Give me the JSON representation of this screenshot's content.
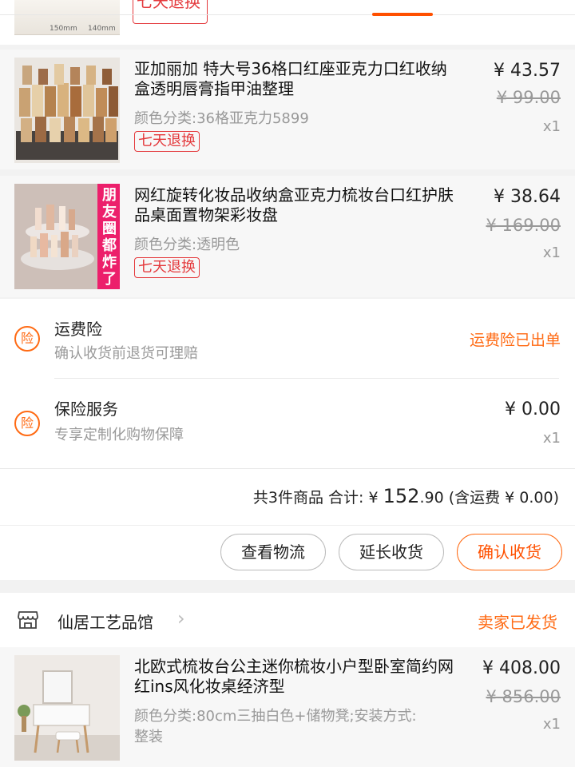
{
  "top_partial": {
    "dim_left": "150mm",
    "dim_right": "140mm",
    "tag": "七天退换"
  },
  "products": [
    {
      "title": "亚加丽加 特大号36格口红座亚克力口红收纳盒透明唇膏指甲油整理",
      "spec": "颜色分类:36格亚克力5899",
      "tag": "七天退换",
      "price": "¥ 43.57",
      "orig_price": "¥ 99.00",
      "qty": "x1"
    },
    {
      "title": "网红旋转化妆品收纳盒亚克力梳妆台口红护肤品桌面置物架彩妆盘",
      "spec": "颜色分类:透明色",
      "tag": "七天退换",
      "img_banner": "朋友圈都炸了",
      "price": "¥ 38.64",
      "orig_price": "¥ 169.00",
      "qty": "x1"
    }
  ],
  "services": {
    "icon_char": "险",
    "shipping_ins": {
      "title": "运费险",
      "subtitle": "确认收货前退货可理赔",
      "status": "运费险已出单"
    },
    "insurance": {
      "title": "保险服务",
      "subtitle": "专享定制化购物保障",
      "price": "¥ 0.00",
      "qty": "x1"
    }
  },
  "summary": {
    "count_label": "共3件商品 合计: ¥ ",
    "total_int": "152",
    "total_dec": ".90",
    "shipping": " (含运费 ¥ 0.00)"
  },
  "actions": {
    "logistics": "查看物流",
    "extend": "延长收货",
    "confirm": "确认收货"
  },
  "store2": {
    "name": "仙居工艺品馆",
    "status": "卖家已发货",
    "product": {
      "title": "北欧式梳妆台公主迷你梳妆小户型卧室简约网红ins风化妆桌经济型",
      "spec_line1": "颜色分类:80cm三抽白色+储物凳;安装方式:",
      "spec_line2": "整装",
      "price": "¥ 408.00",
      "orig_price": "¥ 856.00",
      "qty": "x1"
    }
  },
  "colors": {
    "accent": "#ff5000",
    "tag_red": "#e4393c",
    "muted": "#999999"
  }
}
